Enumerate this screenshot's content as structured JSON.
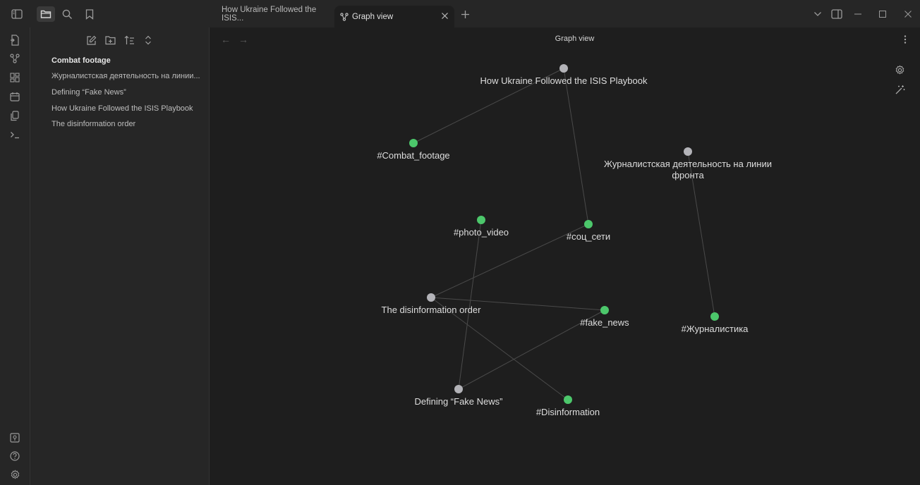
{
  "tabs": [
    {
      "label": "How Ukraine Followed the ISIS..."
    },
    {
      "label": "Graph view"
    }
  ],
  "sidebar": {
    "files": [
      {
        "label": "Combat footage"
      },
      {
        "label": "Журналистская деятельность на линии..."
      },
      {
        "label": "Defining “Fake News”"
      },
      {
        "label": "How Ukraine Followed the ISIS Playbook"
      },
      {
        "label": "The disinformation order"
      }
    ]
  },
  "main": {
    "title": "Graph view"
  },
  "graph": {
    "colors": {
      "note": "#b3b3b8",
      "tag": "#4cc76b",
      "edge": "#4a4a4a"
    },
    "nodes": [
      {
        "id": "isis",
        "label": "How Ukraine Followed the ISIS Playbook",
        "kind": "note"
      },
      {
        "id": "combat",
        "label": "#Combat_footage",
        "kind": "tag"
      },
      {
        "id": "journ",
        "label": "Журналистская деятельность на линии",
        "label2": "фронта",
        "kind": "note"
      },
      {
        "id": "photo",
        "label": "#photo_video",
        "kind": "tag"
      },
      {
        "id": "soc",
        "label": "#соц_сети",
        "kind": "tag"
      },
      {
        "id": "disorder",
        "label": "The disinformation order",
        "kind": "note"
      },
      {
        "id": "fake",
        "label": "#fake_news",
        "kind": "tag"
      },
      {
        "id": "zhurn",
        "label": "#Журналистика",
        "kind": "tag"
      },
      {
        "id": "defining",
        "label": "Defining “Fake News”",
        "kind": "note"
      },
      {
        "id": "disinfo",
        "label": "#Disinformation",
        "kind": "tag"
      }
    ],
    "edges": [
      [
        "isis",
        "combat"
      ],
      [
        "isis",
        "soc"
      ],
      [
        "journ",
        "zhurn"
      ],
      [
        "disorder",
        "soc"
      ],
      [
        "disorder",
        "fake"
      ],
      [
        "disorder",
        "disinfo"
      ],
      [
        "defining",
        "photo"
      ],
      [
        "defining",
        "fake"
      ]
    ]
  }
}
